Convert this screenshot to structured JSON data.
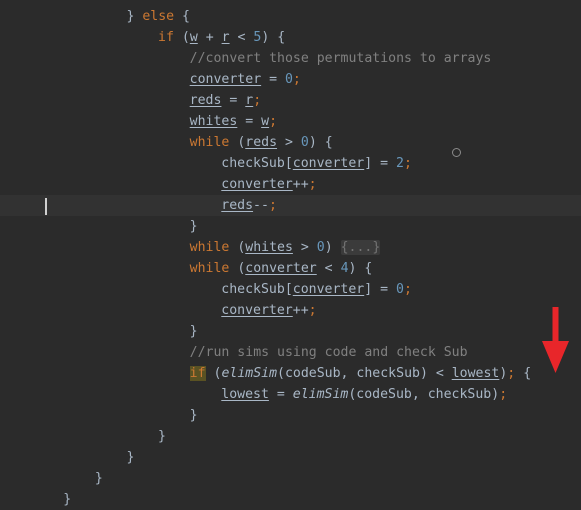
{
  "editor": {
    "theme_name": "darcula",
    "background_color": "#2b2b2b",
    "current_line_color": "#323232",
    "default_text_color": "#a9b7c6",
    "keyword_color": "#cc7832",
    "number_color": "#6897bb",
    "comment_color": "#808080",
    "search_highlight_color": "#5a5223",
    "fold_background_color": "#3b3b3b",
    "caret_color": "#d0d0d0",
    "annotation_arrow_color": "#e8262a",
    "language": "Java",
    "font_size": "13",
    "tab_size": "4"
  },
  "caret": {
    "line_index": 9,
    "column": 5,
    "visible": true
  },
  "annotation": {
    "arrow_direction": "down",
    "points_at_line_index": 17,
    "color": "#e8262a"
  },
  "marker": {
    "shape": "circle-outline",
    "near_line_index": 7
  },
  "code": {
    "lines": [
      {
        "index": 0,
        "indent": 16,
        "current": false,
        "tokens": [
          {
            "text": "} ",
            "type": "brace"
          },
          {
            "text": "else",
            "type": "keyword"
          },
          {
            "text": " {",
            "type": "brace"
          }
        ]
      },
      {
        "index": 1,
        "indent": 20,
        "current": false,
        "tokens": [
          {
            "text": "if",
            "type": "keyword"
          },
          {
            "text": " (",
            "type": "punct"
          },
          {
            "text": "w",
            "type": "param"
          },
          {
            "text": " + ",
            "type": "punct"
          },
          {
            "text": "r",
            "type": "param"
          },
          {
            "text": " < ",
            "type": "punct"
          },
          {
            "text": "5",
            "type": "number"
          },
          {
            "text": ") {",
            "type": "punct"
          }
        ]
      },
      {
        "index": 2,
        "indent": 24,
        "current": false,
        "tokens": [
          {
            "text": "//convert those permutations to arrays",
            "type": "comment"
          }
        ]
      },
      {
        "index": 3,
        "indent": 24,
        "current": false,
        "tokens": [
          {
            "text": "converter",
            "type": "field"
          },
          {
            "text": " = ",
            "type": "punct"
          },
          {
            "text": "0",
            "type": "number"
          },
          {
            "text": ";",
            "type": "semi"
          }
        ]
      },
      {
        "index": 4,
        "indent": 24,
        "current": false,
        "tokens": [
          {
            "text": "reds",
            "type": "field"
          },
          {
            "text": " = ",
            "type": "punct"
          },
          {
            "text": "r",
            "type": "param"
          },
          {
            "text": ";",
            "type": "semi"
          }
        ]
      },
      {
        "index": 5,
        "indent": 24,
        "current": false,
        "tokens": [
          {
            "text": "whites",
            "type": "field"
          },
          {
            "text": " = ",
            "type": "punct"
          },
          {
            "text": "w",
            "type": "param"
          },
          {
            "text": ";",
            "type": "semi"
          }
        ]
      },
      {
        "index": 6,
        "indent": 24,
        "current": false,
        "tokens": [
          {
            "text": "while",
            "type": "keyword"
          },
          {
            "text": " (",
            "type": "punct"
          },
          {
            "text": "reds",
            "type": "field"
          },
          {
            "text": " > ",
            "type": "punct"
          },
          {
            "text": "0",
            "type": "number"
          },
          {
            "text": ") {",
            "type": "punct"
          }
        ]
      },
      {
        "index": 7,
        "indent": 28,
        "current": false,
        "tokens": [
          {
            "text": "checkSub",
            "type": "default"
          },
          {
            "text": "[",
            "type": "punct"
          },
          {
            "text": "converter",
            "type": "field"
          },
          {
            "text": "] = ",
            "type": "punct"
          },
          {
            "text": "2",
            "type": "number"
          },
          {
            "text": ";",
            "type": "semi"
          }
        ]
      },
      {
        "index": 8,
        "indent": 28,
        "current": false,
        "tokens": [
          {
            "text": "converter",
            "type": "field"
          },
          {
            "text": "++",
            "type": "punct"
          },
          {
            "text": ";",
            "type": "semi"
          }
        ]
      },
      {
        "index": 9,
        "indent": 28,
        "current": true,
        "tokens": [
          {
            "text": "reds",
            "type": "field"
          },
          {
            "text": "--",
            "type": "punct"
          },
          {
            "text": ";",
            "type": "semi"
          }
        ]
      },
      {
        "index": 10,
        "indent": 24,
        "current": false,
        "tokens": [
          {
            "text": "}",
            "type": "brace"
          }
        ]
      },
      {
        "index": 11,
        "indent": 24,
        "current": false,
        "tokens": [
          {
            "text": "while",
            "type": "keyword"
          },
          {
            "text": " (",
            "type": "punct"
          },
          {
            "text": "whites",
            "type": "field"
          },
          {
            "text": " > ",
            "type": "punct"
          },
          {
            "text": "0",
            "type": "number"
          },
          {
            "text": ") ",
            "type": "punct"
          },
          {
            "text": "{...}",
            "type": "fold"
          }
        ]
      },
      {
        "index": 12,
        "indent": 24,
        "current": false,
        "tokens": [
          {
            "text": "while",
            "type": "keyword"
          },
          {
            "text": " (",
            "type": "punct"
          },
          {
            "text": "converter",
            "type": "field"
          },
          {
            "text": " < ",
            "type": "punct"
          },
          {
            "text": "4",
            "type": "number"
          },
          {
            "text": ") {",
            "type": "punct"
          }
        ]
      },
      {
        "index": 13,
        "indent": 28,
        "current": false,
        "tokens": [
          {
            "text": "checkSub",
            "type": "default"
          },
          {
            "text": "[",
            "type": "punct"
          },
          {
            "text": "converter",
            "type": "field"
          },
          {
            "text": "] = ",
            "type": "punct"
          },
          {
            "text": "0",
            "type": "number"
          },
          {
            "text": ";",
            "type": "semi"
          }
        ]
      },
      {
        "index": 14,
        "indent": 28,
        "current": false,
        "tokens": [
          {
            "text": "converter",
            "type": "field"
          },
          {
            "text": "++",
            "type": "punct"
          },
          {
            "text": ";",
            "type": "semi"
          }
        ]
      },
      {
        "index": 15,
        "indent": 24,
        "current": false,
        "tokens": [
          {
            "text": "}",
            "type": "brace"
          }
        ]
      },
      {
        "index": 16,
        "indent": 24,
        "current": false,
        "tokens": [
          {
            "text": "//run sims using code and check Sub",
            "type": "comment"
          }
        ]
      },
      {
        "index": 17,
        "indent": 24,
        "current": false,
        "tokens": [
          {
            "text": "if",
            "type": "highlight"
          },
          {
            "text": " (",
            "type": "punct"
          },
          {
            "text": "elimSim",
            "type": "method"
          },
          {
            "text": "(codeSub, checkSub) < ",
            "type": "punct"
          },
          {
            "text": "lowest",
            "type": "field"
          },
          {
            "text": ")",
            "type": "punct"
          },
          {
            "text": ";",
            "type": "semi"
          },
          {
            "text": " {",
            "type": "punct"
          }
        ]
      },
      {
        "index": 18,
        "indent": 28,
        "current": false,
        "tokens": [
          {
            "text": "lowest",
            "type": "field"
          },
          {
            "text": " = ",
            "type": "punct"
          },
          {
            "text": "elimSim",
            "type": "method"
          },
          {
            "text": "(codeSub, checkSub)",
            "type": "punct"
          },
          {
            "text": ";",
            "type": "semi"
          }
        ]
      },
      {
        "index": 19,
        "indent": 24,
        "current": false,
        "tokens": [
          {
            "text": "}",
            "type": "brace"
          }
        ]
      },
      {
        "index": 20,
        "indent": 20,
        "current": false,
        "tokens": [
          {
            "text": "}",
            "type": "brace"
          }
        ]
      },
      {
        "index": 21,
        "indent": 16,
        "current": false,
        "tokens": [
          {
            "text": "}",
            "type": "brace"
          }
        ]
      },
      {
        "index": 22,
        "indent": 12,
        "current": false,
        "tokens": [
          {
            "text": "}",
            "type": "brace"
          }
        ]
      },
      {
        "index": 23,
        "indent": 8,
        "current": false,
        "tokens": [
          {
            "text": "}",
            "type": "brace"
          }
        ]
      }
    ]
  }
}
